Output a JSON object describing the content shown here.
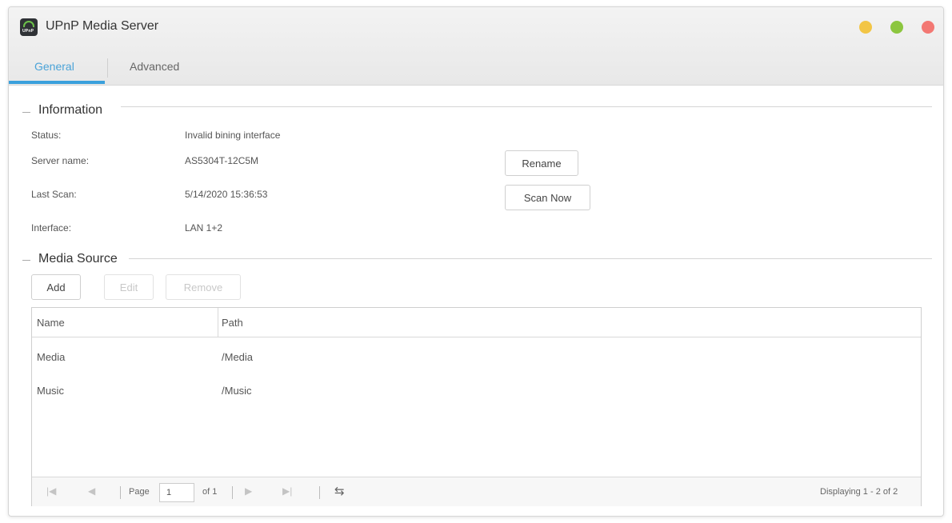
{
  "window": {
    "title": "UPnP Media Server",
    "icon_name": "upnp-app-icon",
    "icon_text": "UPnP",
    "controls": [
      {
        "name": "minimize-dot",
        "color": "#f2c545"
      },
      {
        "name": "maximize-dot",
        "color": "#8cc63f"
      },
      {
        "name": "close-dot",
        "color": "#f37873"
      }
    ]
  },
  "tabs": [
    {
      "label": "General",
      "active": true
    },
    {
      "label": "Advanced",
      "active": false
    }
  ],
  "information": {
    "title": "Information",
    "rows": [
      {
        "label": "Status:",
        "value": "Invalid bining interface"
      },
      {
        "label": "Server name:",
        "value": "AS5304T-12C5M"
      },
      {
        "label": "Last Scan:",
        "value": "5/14/2020 15:36:53"
      },
      {
        "label": "Interface:",
        "value": "LAN 1+2"
      }
    ],
    "rename_label": "Rename",
    "scan_now_label": "Scan Now"
  },
  "media_source": {
    "title": "Media Source",
    "add_label": "Add",
    "edit_label": "Edit",
    "remove_label": "Remove",
    "columns": [
      "Name",
      "Path"
    ],
    "rows": [
      {
        "name": "Media",
        "path": "/Media"
      },
      {
        "name": "Music",
        "path": "/Music"
      }
    ],
    "pager": {
      "page_label": "Page",
      "page_value": "1",
      "of_label": "of 1",
      "display_text": "Displaying 1 - 2 of 2"
    }
  },
  "colors": {
    "accent": "#3aa0dc",
    "active_tab_text": "#4aa3d8"
  }
}
